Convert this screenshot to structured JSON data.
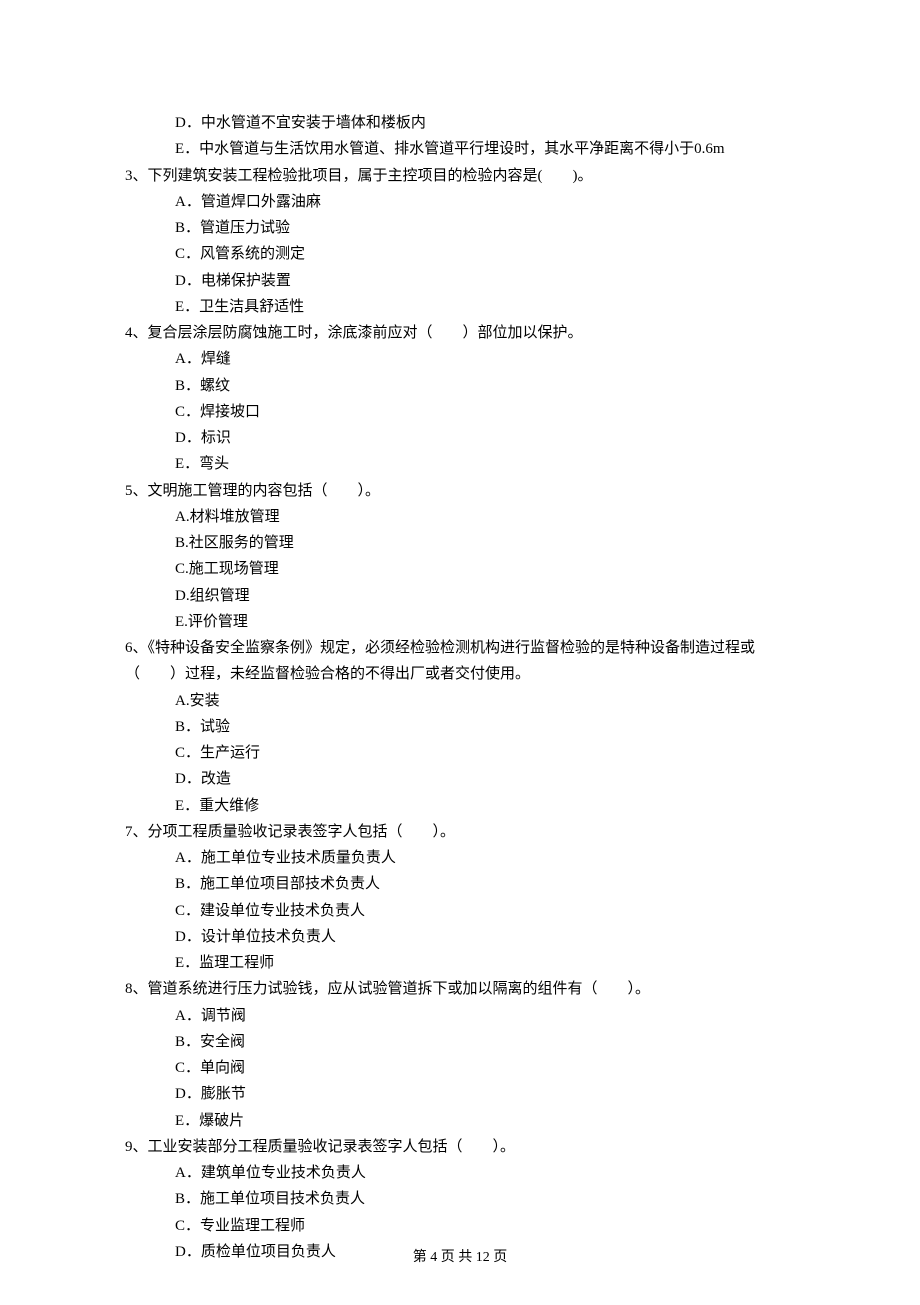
{
  "continuation_options": [
    "D．中水管道不宜安装于墙体和楼板内",
    "E．中水管道与生活饮用水管道、排水管道平行埋设时，其水平净距离不得小于0.6m"
  ],
  "questions": [
    {
      "stem": "3、下列建筑安装工程检验批项目，属于主控项目的检验内容是(　　)。",
      "options": [
        "A．管道焊口外露油麻",
        "B．管道压力试验",
        "C．风管系统的测定",
        "D．电梯保护装置",
        "E．卫生洁具舒适性"
      ]
    },
    {
      "stem": "4、复合层涂层防腐蚀施工时，涂底漆前应对（　　）部位加以保护。",
      "options": [
        "A．焊缝",
        "B．螺纹",
        "C．焊接坡口",
        "D．标识",
        "E．弯头"
      ]
    },
    {
      "stem": "5、文明施工管理的内容包括（　　）。",
      "options": [
        "A.材料堆放管理",
        "B.社区服务的管理",
        "C.施工现场管理",
        "D.组织管理",
        "E.评价管理"
      ]
    },
    {
      "stem": "6、《特种设备安全监察条例》规定，必须经检验检测机构进行监督检验的是特种设备制造过程或（　　）过程，未经监督检验合格的不得出厂或者交付使用。",
      "options": [
        "A.安装",
        "B．试验",
        "C．生产运行",
        "D．改造",
        "E．重大维修"
      ]
    },
    {
      "stem": "7、分项工程质量验收记录表签字人包括（　　）。",
      "options": [
        "A．施工单位专业技术质量负责人",
        "B．施工单位项目部技术负责人",
        "C．建设单位专业技术负责人",
        "D．设计单位技术负责人",
        "E．监理工程师"
      ]
    },
    {
      "stem": "8、管道系统进行压力试验钱，应从试验管道拆下或加以隔离的组件有（　　）。",
      "options": [
        "A．调节阀",
        "B．安全阀",
        "C．单向阀",
        "D．膨胀节",
        "E．爆破片"
      ]
    },
    {
      "stem": "9、工业安装部分工程质量验收记录表签字人包括（　　）。",
      "options": [
        "A．建筑单位专业技术负责人",
        "B．施工单位项目技术负责人",
        "C．专业监理工程师",
        "D．质检单位项目负责人"
      ]
    }
  ],
  "footer": "第 4 页 共 12 页"
}
